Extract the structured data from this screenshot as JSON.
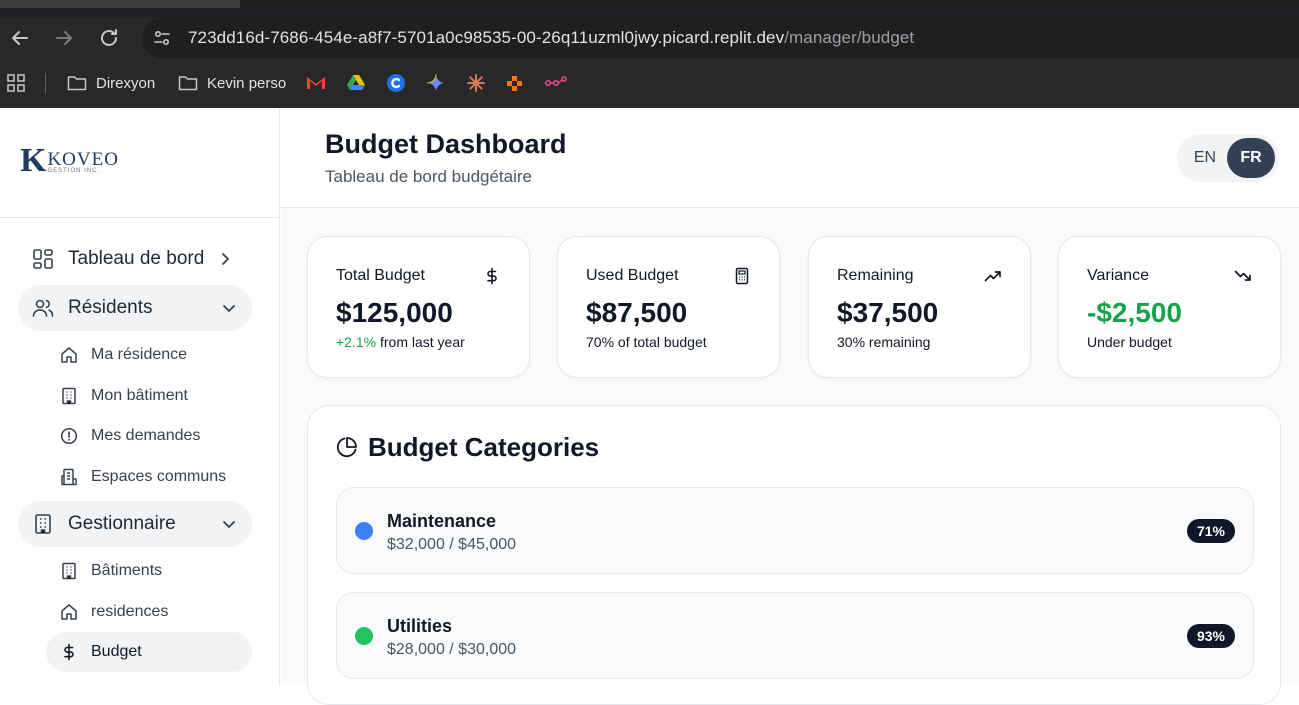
{
  "browser": {
    "url_host": "723dd16d-7686-454e-a8f7-5701a0c98535-00-26q11uzml0jwy.picard.replit.dev",
    "url_path": "/manager/budget",
    "bookmarks": [
      {
        "label": "Direxyon",
        "icon": "folder-icon"
      },
      {
        "label": "Kevin perso",
        "icon": "folder-icon"
      },
      {
        "label": "",
        "icon": "gmail-icon"
      },
      {
        "label": "",
        "icon": "google-drive-icon"
      },
      {
        "label": "",
        "icon": "c-app-icon"
      },
      {
        "label": "",
        "icon": "gemini-icon"
      },
      {
        "label": "",
        "icon": "claude-icon"
      },
      {
        "label": "",
        "icon": "app-icon-orange"
      },
      {
        "label": "",
        "icon": "flow-icon"
      }
    ]
  },
  "logo": {
    "brand": "KOVEO",
    "sub": "GESTION INC."
  },
  "sidebar": {
    "dashboard": "Tableau de bord",
    "residents_group": "Résidents",
    "residents_items": [
      "Ma résidence",
      "Mon bâtiment",
      "Mes demandes",
      "Espaces communs"
    ],
    "manager_group": "Gestionnaire",
    "manager_items": [
      "Bâtiments",
      "residences",
      "Budget"
    ]
  },
  "header": {
    "title": "Budget Dashboard",
    "subtitle": "Tableau de bord budgétaire",
    "lang_en": "EN",
    "lang_fr": "FR",
    "active_lang": "FR"
  },
  "cards": [
    {
      "title": "Total Budget",
      "icon": "dollar-icon",
      "value": "$125,000",
      "note_highlight": "+2.1%",
      "note": " from last year"
    },
    {
      "title": "Used Budget",
      "icon": "calculator-icon",
      "value": "$87,500",
      "note_highlight": "",
      "note": "70% of total budget"
    },
    {
      "title": "Remaining",
      "icon": "trending-up-icon",
      "value": "$37,500",
      "note_highlight": "",
      "note": "30% remaining"
    },
    {
      "title": "Variance",
      "icon": "trending-down-icon",
      "value": "-$2,500",
      "note_highlight": "",
      "note": "Under budget"
    }
  ],
  "categories": {
    "title": "Budget Categories",
    "items": [
      {
        "name": "Maintenance",
        "amount": "$32,000 / $45,000",
        "pct": "71%",
        "color": "#3b82f6"
      },
      {
        "name": "Utilities",
        "amount": "$28,000 / $30,000",
        "pct": "93%",
        "color": "#22c55e"
      }
    ]
  },
  "colors": {
    "accent_dark": "#334155",
    "positive": "#16a34a"
  }
}
